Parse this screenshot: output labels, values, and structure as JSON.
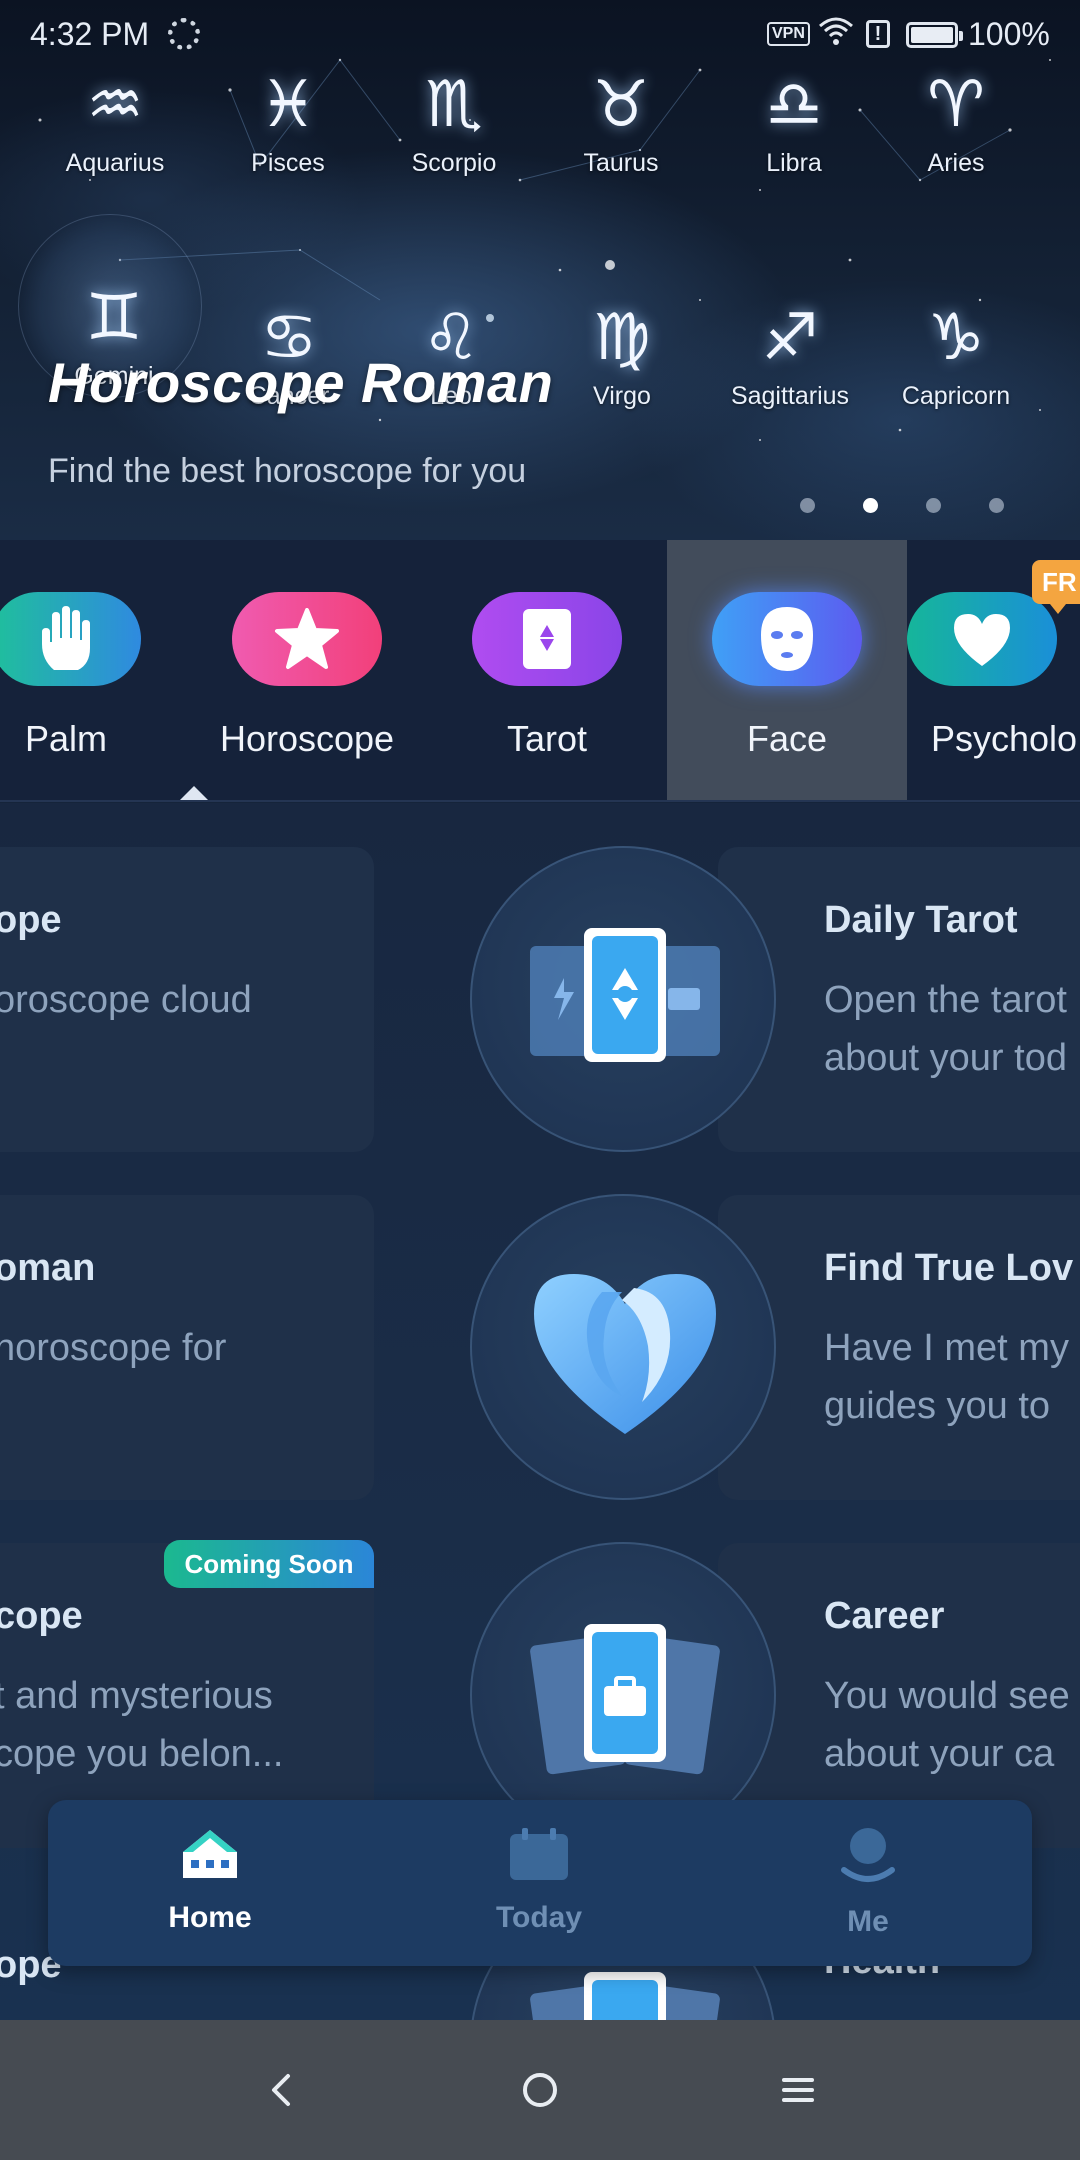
{
  "status_bar": {
    "time": "4:32 PM",
    "vpn": "VPN",
    "battery": "100%"
  },
  "hero": {
    "title": "Horoscope Roman",
    "subtitle": "Find the best horoscope for you",
    "page_indicator": {
      "count": 4,
      "active": 2
    },
    "signs_row1": [
      {
        "name": "Aquarius",
        "glyph": "♒"
      },
      {
        "name": "Pisces",
        "glyph": "♓"
      },
      {
        "name": "Scorpio",
        "glyph": "♏"
      },
      {
        "name": "Taurus",
        "glyph": "♉"
      },
      {
        "name": "Libra",
        "glyph": "♎"
      },
      {
        "name": "Aries",
        "glyph": "♈"
      }
    ],
    "signs_row2": [
      {
        "name": "Gemini",
        "glyph": "♊"
      },
      {
        "name": "Cancer",
        "glyph": "♋"
      },
      {
        "name": "Leo",
        "glyph": "♌"
      },
      {
        "name": "Virgo",
        "glyph": "♍"
      },
      {
        "name": "Sagittarius",
        "glyph": "♐"
      },
      {
        "name": "Capricorn",
        "glyph": "♑"
      }
    ]
  },
  "categories": {
    "items": [
      {
        "label": "Palm",
        "icon": "hand-icon"
      },
      {
        "label": "Horoscope",
        "icon": "star-icon"
      },
      {
        "label": "Tarot",
        "icon": "tarot-card-icon"
      },
      {
        "label": "Face",
        "icon": "face-mask-icon"
      },
      {
        "label": "Psycholo",
        "icon": "heart-icon"
      }
    ],
    "selected": "Face",
    "free_badge": "FR",
    "colors": {
      "palm": "#1db8a6",
      "horoscope": "#f2489b",
      "tarot": "#a04bf0",
      "face": "#3f7cf4",
      "psychology": "#15b79a"
    }
  },
  "cards": {
    "left": [
      {
        "title": "ope",
        "desc": [
          "oroscope cloud"
        ]
      },
      {
        "title": "oman",
        "desc": [
          "horoscope for"
        ]
      },
      {
        "title": "cope",
        "desc": [
          "t and mysterious",
          "cope you belon..."
        ],
        "badge": "Coming Soon"
      }
    ],
    "right": [
      {
        "title": "Daily Tarot",
        "desc": [
          "Open the tarot",
          "about your tod"
        ],
        "icon": "tarot-cards-icon"
      },
      {
        "title": "Find True Lov",
        "desc": [
          "Have I met my",
          "guides you to"
        ],
        "icon": "heart-face-icon"
      },
      {
        "title": "Career",
        "desc": [
          "You would see",
          "about your ca"
        ],
        "icon": "career-card-icon"
      }
    ],
    "partial_left_title": "ope",
    "partial_right_title": "Health"
  },
  "bottom_nav": {
    "items": [
      {
        "label": "Home",
        "icon": "home-icon",
        "active": true
      },
      {
        "label": "Today",
        "icon": "calendar-icon",
        "active": false
      },
      {
        "label": "Me",
        "icon": "person-icon",
        "active": false
      }
    ]
  },
  "system_nav": {
    "back": "back-icon",
    "home": "home-circle-icon",
    "menu": "menu-icon"
  }
}
